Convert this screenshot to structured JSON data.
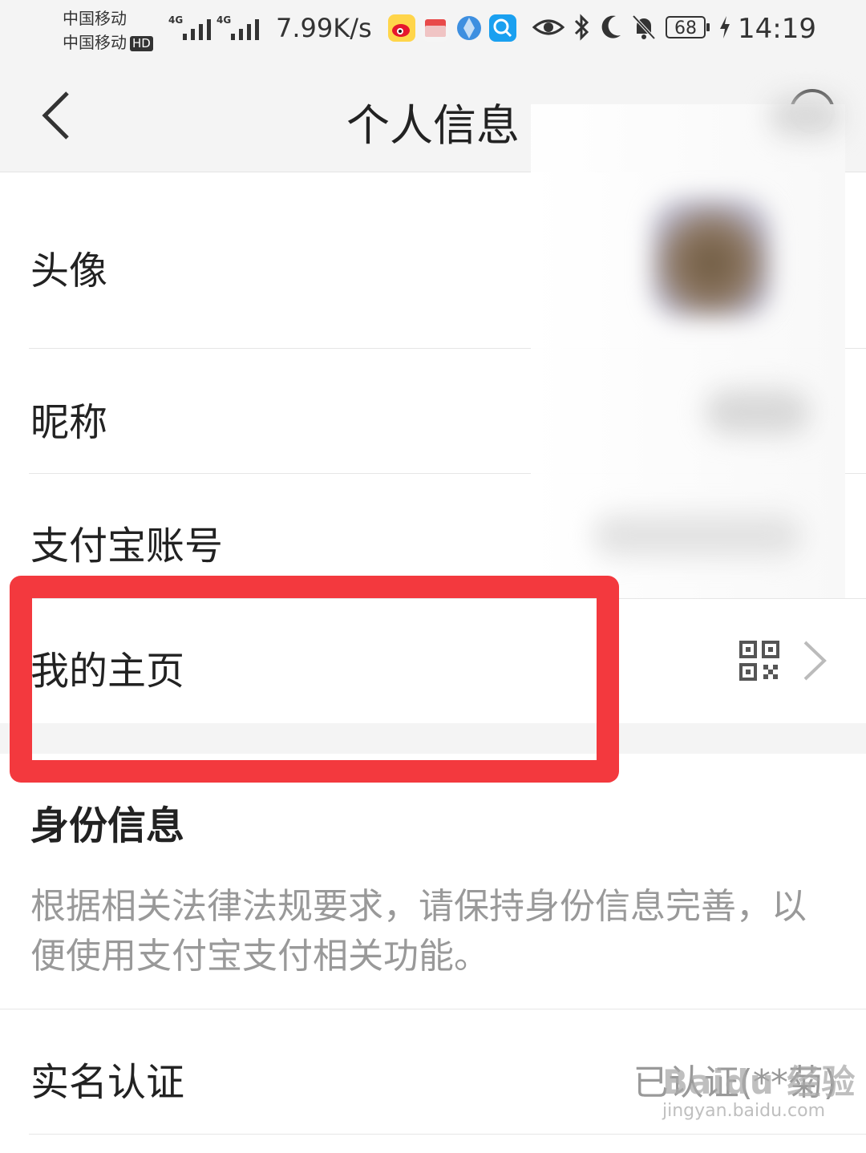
{
  "status_bar": {
    "carrier_1": "中国移动",
    "carrier_2": "中国移动",
    "hd": "HD",
    "net_1": "4G",
    "net_2": "4G",
    "speed": "7.99K/s",
    "battery": "68",
    "time": "14:19",
    "icons": [
      "weibo-icon",
      "pinduoduo-icon",
      "browser-icon",
      "search-app-icon",
      "eye-icon",
      "bluetooth-icon",
      "moon-icon",
      "bell-off-icon",
      "battery-icon",
      "charging-icon"
    ]
  },
  "nav": {
    "title": "个人信息",
    "back_icon": "chevron-left-icon",
    "more_icon": "more-icon"
  },
  "profile": {
    "avatar_label": "头像",
    "nickname_label": "昵称",
    "account_label": "支付宝账号",
    "homepage_label": "我的主页",
    "homepage_icons": [
      "qr-code-icon",
      "chevron-right-icon"
    ]
  },
  "identity": {
    "title": "身份信息",
    "description": "根据相关法律法规要求，请保持身份信息完善，以便使用支付宝支付相关功能。",
    "realname_label": "实名认证",
    "realname_value": "已认证(**菊)"
  },
  "watermark": {
    "main": "Baidu 经验",
    "sub": "jingyan.baidu.com"
  },
  "colors": {
    "highlight": "#f3393e",
    "background": "#f4f4f4",
    "muted_text": "#999999"
  }
}
